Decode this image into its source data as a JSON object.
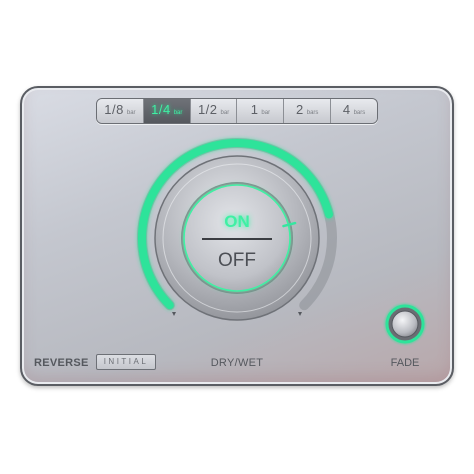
{
  "rate_selector": {
    "options": [
      {
        "main": "1/8",
        "unit": "bar"
      },
      {
        "main": "1/4",
        "unit": "bar"
      },
      {
        "main": "1/2",
        "unit": "bar"
      },
      {
        "main": "1",
        "unit": "bar"
      },
      {
        "main": "2",
        "unit": "bars"
      },
      {
        "main": "4",
        "unit": "bars"
      }
    ],
    "selected_index": 1
  },
  "main_switch": {
    "on_label": "ON",
    "off_label": "OFF",
    "state": "on"
  },
  "drywet": {
    "label": "DRY/WET",
    "level": 0.78
  },
  "reverse": {
    "label": "REVERSE",
    "mode_label": "INITIAL"
  },
  "fade": {
    "label": "FADE"
  },
  "colors": {
    "accent": "#3ff0a4",
    "panel": "#c4c7cf",
    "text": "#55585e"
  }
}
